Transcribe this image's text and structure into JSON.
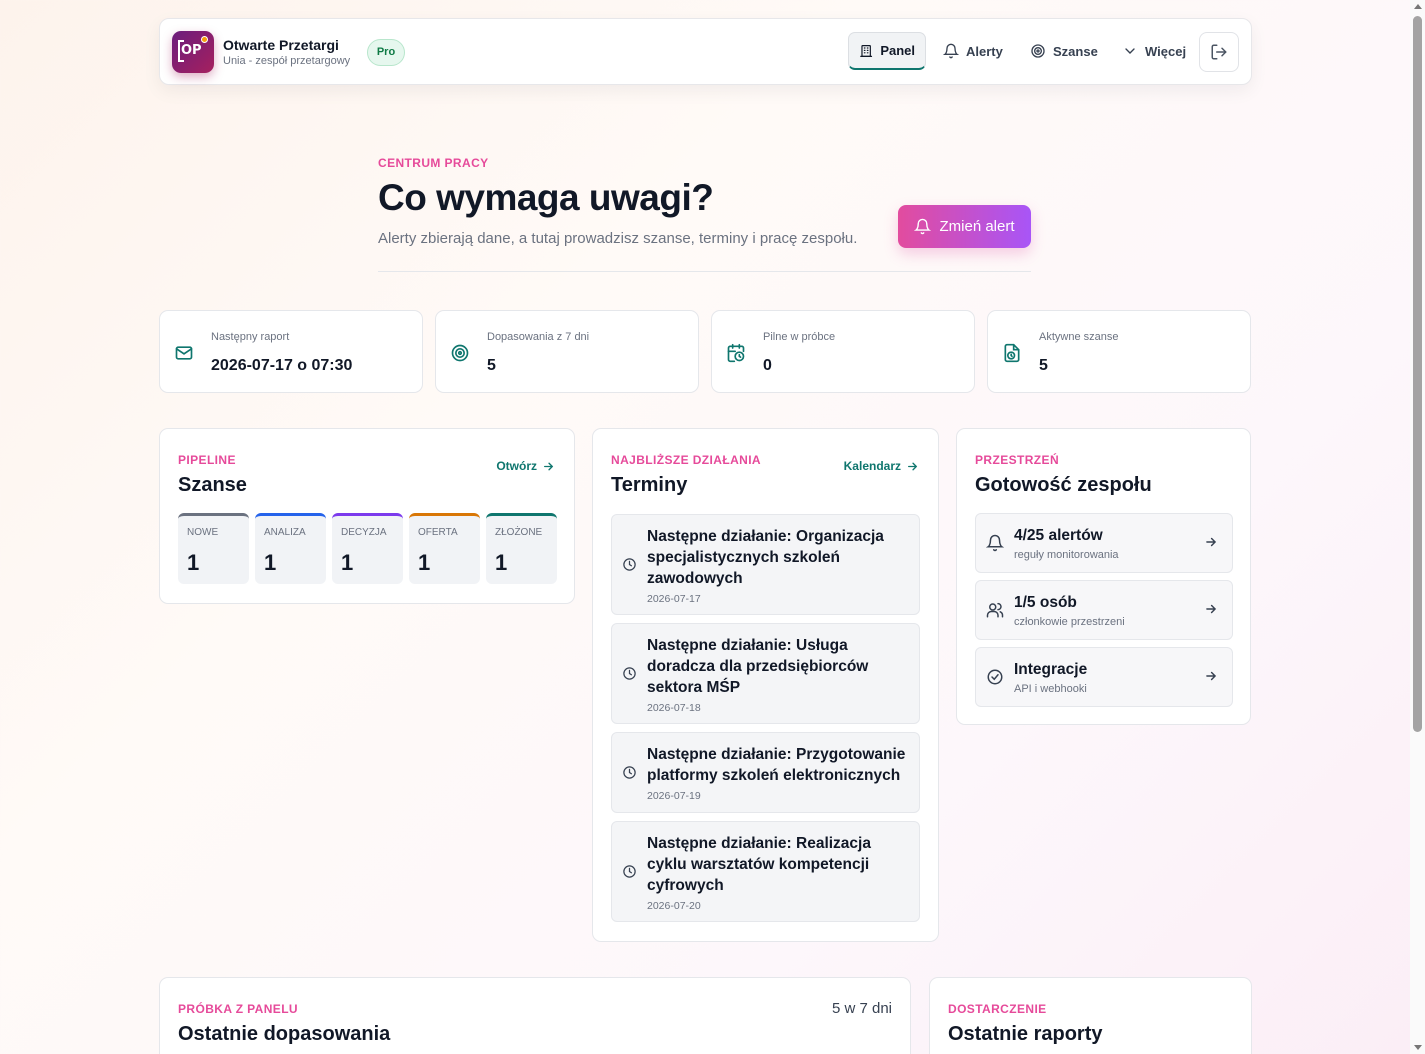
{
  "header": {
    "brand_title": "Otwarte Przetargi",
    "brand_subtitle": "Unia - zespół przetargowy",
    "logo_text": "OP",
    "plan_badge": "Pro",
    "nav": [
      {
        "label": "Panel",
        "icon": "building-icon",
        "active": true
      },
      {
        "label": "Alerty",
        "icon": "bell-icon"
      },
      {
        "label": "Szanse",
        "icon": "target-icon"
      },
      {
        "label": "Więcej",
        "icon": "chevron-down-icon"
      }
    ],
    "logout_icon": "logout-icon"
  },
  "hero": {
    "eyebrow": "CENTRUM PRACY",
    "title": "Co wymaga uwagi?",
    "subtitle": "Alerty zbierają dane, a tutaj prowadzisz szanse, terminy i pracę zespołu.",
    "button_label": "Zmień alert"
  },
  "stats": [
    {
      "label": "Następny raport",
      "value": "2026-07-17 o 07:30",
      "icon": "mail-icon"
    },
    {
      "label": "Dopasowania z 7 dni",
      "value": "5",
      "icon": "target-icon"
    },
    {
      "label": "Pilne w próbce",
      "value": "0",
      "icon": "calendar-clock-icon"
    },
    {
      "label": "Aktywne szanse",
      "value": "5",
      "icon": "file-clock-icon"
    }
  ],
  "pipeline": {
    "eyebrow": "PIPELINE",
    "title": "Szanse",
    "link": "Otwórz",
    "stages": [
      {
        "label": "NOWE",
        "value": "1",
        "color": "#6b7280"
      },
      {
        "label": "ANALIZA",
        "value": "1",
        "color": "#2563eb"
      },
      {
        "label": "DECYZJA",
        "value": "1",
        "color": "#7c3aed"
      },
      {
        "label": "OFERTA",
        "value": "1",
        "color": "#d97706"
      },
      {
        "label": "ZŁOŻONE",
        "value": "1",
        "color": "#0f766e"
      }
    ]
  },
  "deadlines": {
    "eyebrow": "NAJBLIŻSZE DZIAŁANIA",
    "title": "Terminy",
    "link": "Kalendarz",
    "items": [
      {
        "title": "Następne działanie: Organizacja specjalistycznych szkoleń zawodowych",
        "date": "2026-07-17"
      },
      {
        "title": "Następne działanie: Usługa doradcza dla przedsiębiorców sektora MŚP",
        "date": "2026-07-18"
      },
      {
        "title": "Następne działanie: Przygotowanie platformy szkoleń elektronicznych",
        "date": "2026-07-19"
      },
      {
        "title": "Następne działanie: Realizacja cyklu warsztatów kompetencji cyfrowych",
        "date": "2026-07-20"
      }
    ]
  },
  "workspace": {
    "eyebrow": "PRZESTRZEŃ",
    "title": "Gotowość zespołu",
    "items": [
      {
        "title": "4/25 alertów",
        "subtitle": "reguły monitorowania",
        "icon": "bell-icon"
      },
      {
        "title": "1/5 osób",
        "subtitle": "członkowie przestrzeni",
        "icon": "users-icon"
      },
      {
        "title": "Integracje",
        "subtitle": "API i webhooki",
        "icon": "check-circle-icon"
      }
    ]
  },
  "recent_matches": {
    "eyebrow": "PRÓBKA Z PANELU",
    "title": "Ostatnie dopasowania",
    "count": "5 w 7 dni"
  },
  "delivery": {
    "eyebrow": "DOSTARCZENIE",
    "title": "Ostatnie raporty"
  },
  "colors": {
    "accent_pink": "#e64a9a",
    "accent_teal": "#0f766e",
    "button_gradient_end": "#a855f7"
  }
}
